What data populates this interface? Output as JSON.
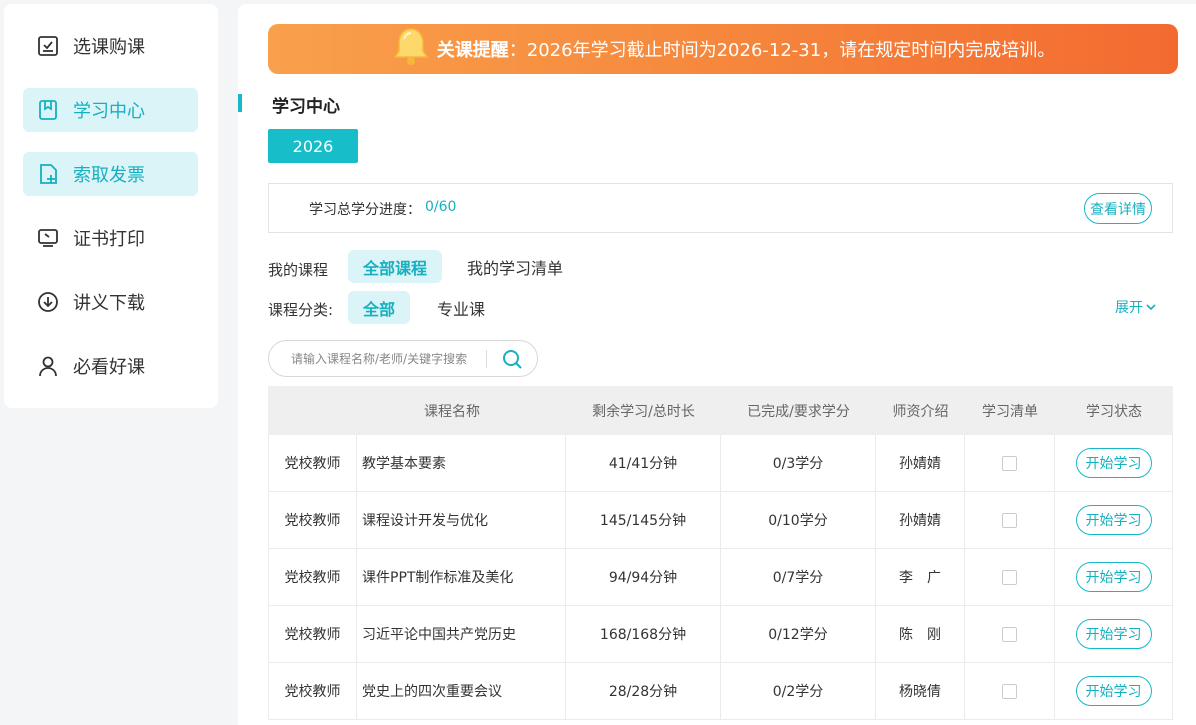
{
  "sidebar": {
    "items": [
      {
        "label": "选课购课",
        "icon": "checkbox-icon",
        "active": false
      },
      {
        "label": "学习中心",
        "icon": "bookmark-icon",
        "active": true
      },
      {
        "label": "索取发票",
        "icon": "file-add-icon",
        "active": true
      },
      {
        "label": "证书打印",
        "icon": "monitor-icon",
        "active": false
      },
      {
        "label": "讲义下载",
        "icon": "download-circle-icon",
        "active": false
      },
      {
        "label": "必看好课",
        "icon": "user-icon",
        "active": false
      }
    ]
  },
  "banner": {
    "strong": "关课提醒",
    "text": "：2026年学习截止时间为2026-12-31，请在规定时间内完成培训。"
  },
  "section": {
    "title": "学习中心"
  },
  "year_tab": "2026",
  "progress": {
    "label": "学习总学分进度：",
    "value": "0/60",
    "detail_button": "查看详情"
  },
  "courses_row": {
    "label": "我的课程",
    "tab_all": "全部课程",
    "tab_list": "我的学习清单"
  },
  "category_row": {
    "label": "课程分类:",
    "all": "全部",
    "professional": "专业课",
    "expand": "展开"
  },
  "search": {
    "placeholder": "请输入课程名称/老师/关键字搜索"
  },
  "table": {
    "headers": [
      "课程名称",
      "剩余学习/总时长",
      "已完成/要求学分",
      "师资介绍",
      "学习清单",
      "学习状态"
    ],
    "rows": [
      {
        "category": "党校教师",
        "name": "教学基本要素",
        "time": "41/41分钟",
        "credit": "0/3学分",
        "teacher": "孙婧婧",
        "action": "开始学习"
      },
      {
        "category": "党校教师",
        "name": "课程设计开发与优化",
        "time": "145/145分钟",
        "credit": "0/10学分",
        "teacher": "孙婧婧",
        "action": "开始学习"
      },
      {
        "category": "党校教师",
        "name": "课件PPT制作标准及美化",
        "time": "94/94分钟",
        "credit": "0/7学分",
        "teacher": "李　广",
        "action": "开始学习"
      },
      {
        "category": "党校教师",
        "name": "习近平论中国共产党历史",
        "time": "168/168分钟",
        "credit": "0/12学分",
        "teacher": "陈　刚",
        "action": "开始学习"
      },
      {
        "category": "党校教师",
        "name": "党史上的四次重要会议",
        "time": "28/28分钟",
        "credit": "0/2学分",
        "teacher": "杨晓倩",
        "action": "开始学习"
      }
    ]
  },
  "colors": {
    "accent": "#17b8c8",
    "active_bg": "#daf4f7",
    "banner_start": "#f9a04c",
    "banner_end": "#f36a30"
  }
}
